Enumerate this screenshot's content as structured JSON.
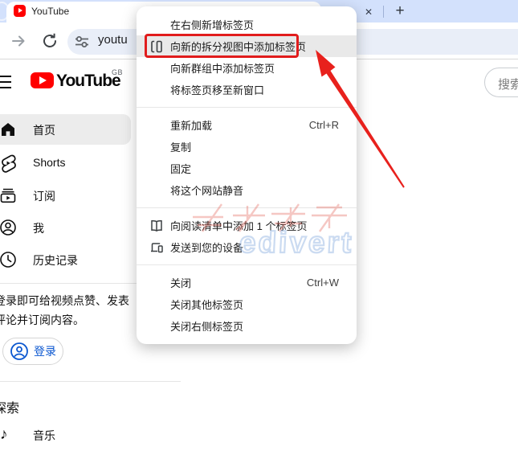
{
  "browser": {
    "active_tab_title": "YouTube",
    "close_tab_glyph": "✕",
    "new_tab_glyph": "+",
    "address_bar_text": "youtu"
  },
  "context_menu": {
    "groups": [
      {
        "items": [
          {
            "label": "在右侧新增标签页"
          },
          {
            "label": "向新的拆分视图中添加标签页",
            "icon": "split-view",
            "highlighted": true
          },
          {
            "label": "向新群组中添加标签页"
          },
          {
            "label": "将标签页移至新窗口"
          }
        ]
      },
      {
        "items": [
          {
            "label": "重新加载",
            "shortcut": "Ctrl+R"
          },
          {
            "label": "复制"
          },
          {
            "label": "固定"
          },
          {
            "label": "将这个网站静音"
          }
        ]
      },
      {
        "items": [
          {
            "label": "向阅读清单中添加 1 个标签页",
            "icon": "reading-list"
          },
          {
            "label": "发送到您的设备",
            "icon": "send-to-device"
          }
        ]
      },
      {
        "items": [
          {
            "label": "关闭",
            "shortcut": "Ctrl+W"
          },
          {
            "label": "关闭其他标签页"
          },
          {
            "label": "关闭右侧标签页"
          }
        ]
      }
    ]
  },
  "youtube": {
    "wordmark": "YouTube",
    "region_code": "GB",
    "search_placeholder": "搜索",
    "sidebar_items": [
      {
        "label": "首页",
        "active": true
      },
      {
        "label": "Shorts"
      },
      {
        "label": "订阅"
      },
      {
        "label": "我"
      },
      {
        "label": "历史记录"
      }
    ],
    "signin_hint_line1": "登录即可给视频点赞、发表",
    "signin_hint_line2": "评论并订阅内容。",
    "signin_button_label": "登录",
    "explore_heading": "探索",
    "explore_item_music": "音乐",
    "music_note_glyph": "♪"
  },
  "watermark": {
    "latin": "edivert"
  },
  "colors": {
    "tabstrip": "#d3e1fc",
    "address_pill": "#e9eef8",
    "highlight_red": "#e11c1c",
    "youtube_red": "#ff0000",
    "signin_blue": "#0b57d0"
  }
}
